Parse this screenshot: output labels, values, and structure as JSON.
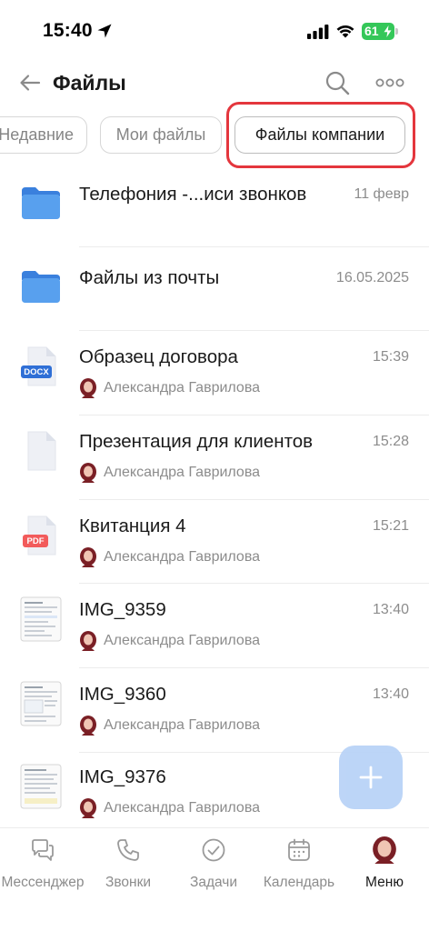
{
  "status_bar": {
    "time": "15:40",
    "battery": "61"
  },
  "header": {
    "back_icon": "back-arrow-icon",
    "title": "Файлы",
    "search_icon": "search-icon",
    "more_icon": "more-icon"
  },
  "tabs": [
    {
      "label": "Недавние",
      "active": false
    },
    {
      "label": "Мои файлы",
      "active": false
    },
    {
      "label": "Файлы компании",
      "active": true
    }
  ],
  "files": [
    {
      "name": "Телефония -...иси звонков",
      "date": "11 февр",
      "type": "folder",
      "owner": ""
    },
    {
      "name": "Файлы из почты",
      "date": "16.05.2025",
      "type": "folder",
      "owner": ""
    },
    {
      "name": "Образец договора",
      "date": "15:39",
      "type": "docx",
      "badge": "DOCX",
      "owner": "Александра Гаврилова"
    },
    {
      "name": "Презентация для клиентов",
      "date": "15:28",
      "type": "blank",
      "owner": "Александра Гаврилова"
    },
    {
      "name": "Квитанция 4",
      "date": "15:21",
      "type": "pdf",
      "badge": "PDF",
      "owner": "Александра Гаврилова"
    },
    {
      "name": "IMG_9359",
      "date": "13:40",
      "type": "image",
      "owner": "Александра Гаврилова"
    },
    {
      "name": "IMG_9360",
      "date": "13:40",
      "type": "image",
      "owner": "Александра Гаврилова"
    },
    {
      "name": "IMG_9376",
      "date": "",
      "type": "image",
      "owner": "Александра Гаврилова"
    }
  ],
  "fab": {
    "icon": "plus-icon"
  },
  "bottom_nav": [
    {
      "label": "Мессенджер",
      "icon": "messenger-icon",
      "active": false
    },
    {
      "label": "Звонки",
      "icon": "phone-icon",
      "active": false
    },
    {
      "label": "Задачи",
      "icon": "tasks-icon",
      "active": false
    },
    {
      "label": "Календарь",
      "icon": "calendar-icon",
      "active": false
    },
    {
      "label": "Меню",
      "icon": "avatar",
      "active": true
    }
  ],
  "colors": {
    "highlight": "#e4363d",
    "folder": "#4a90e2",
    "pdf": "#f25b5b",
    "docx": "#2f6fd6",
    "battery": "#34c759",
    "fab": "#b9d3f7"
  }
}
